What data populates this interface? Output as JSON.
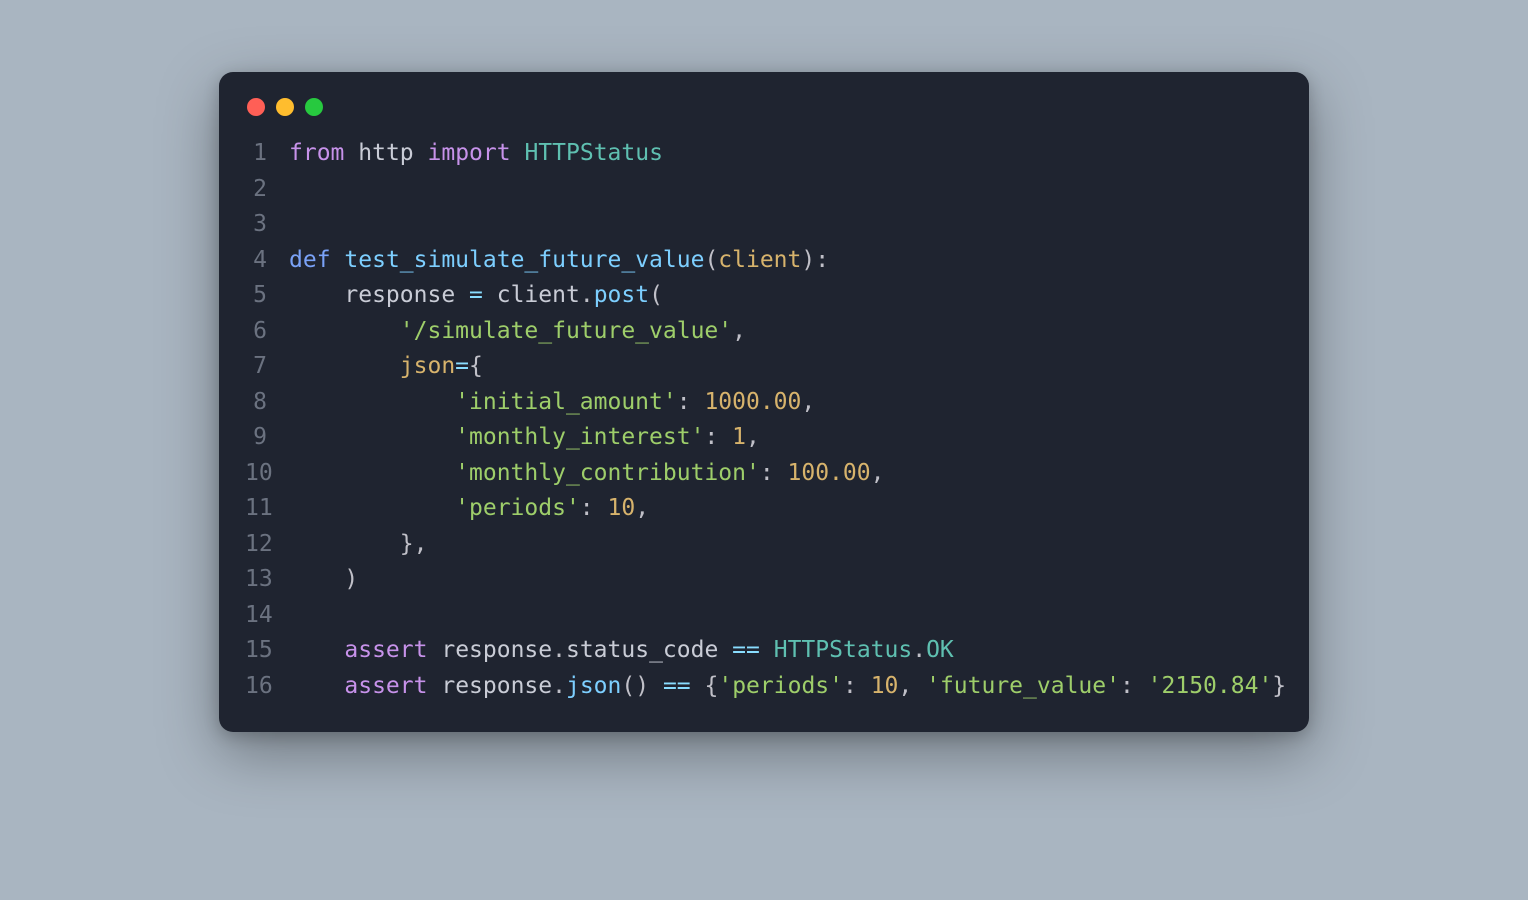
{
  "window": {
    "traffic_lights": {
      "red": "red",
      "yellow": "yellow",
      "green": "green"
    }
  },
  "gutter": [
    "1",
    "2",
    "3",
    "4",
    "5",
    "6",
    "7",
    "8",
    "9",
    "10",
    "11",
    "12",
    "13",
    "14",
    "15",
    "16"
  ],
  "code": {
    "l1": {
      "from": "from",
      "mod": "http",
      "import": "import",
      "cls": "HTTPStatus"
    },
    "l4": {
      "def": "def",
      "fn": "test_simulate_future_value",
      "lp": "(",
      "param": "client",
      "rp": "):"
    },
    "l5": {
      "lhs": "    response ",
      "eq": "=",
      "sp": " ",
      "obj": "client",
      "dot": ".",
      "meth": "post",
      "lp": "("
    },
    "l6": {
      "indent": "        ",
      "str": "'/simulate_future_value'",
      "comma": ","
    },
    "l7": {
      "indent": "        ",
      "kw": "json",
      "eq": "=",
      "brace": "{"
    },
    "l8": {
      "indent": "            ",
      "key": "'initial_amount'",
      "colon": ": ",
      "val": "1000.00",
      "comma": ","
    },
    "l9": {
      "indent": "            ",
      "key": "'monthly_interest'",
      "colon": ": ",
      "val": "1",
      "comma": ","
    },
    "l10": {
      "indent": "            ",
      "key": "'monthly_contribution'",
      "colon": ": ",
      "val": "100.00",
      "comma": ","
    },
    "l11": {
      "indent": "            ",
      "key": "'periods'",
      "colon": ": ",
      "val": "10",
      "comma": ","
    },
    "l12": {
      "indent": "        ",
      "brace": "},",
      "extra": ""
    },
    "l13": {
      "indent": "    ",
      "rp": ")"
    },
    "l15": {
      "indent": "    ",
      "assert": "assert",
      "sp": " ",
      "obj": "response",
      "dot1": ".",
      "attr": "status_code",
      "sp2": " ",
      "eq": "==",
      "sp3": " ",
      "cls": "HTTPStatus",
      "dot2": ".",
      "ok": "OK"
    },
    "l16": {
      "indent": "    ",
      "assert": "assert",
      "sp": " ",
      "obj": "response",
      "dot": ".",
      "meth": "json",
      "call": "()",
      "sp2": " ",
      "eq": "==",
      "sp3": " ",
      "lb": "{",
      "k1": "'periods'",
      "c1": ": ",
      "v1": "10",
      "comma": ", ",
      "k2": "'future_value'",
      "c2": ": ",
      "v2": "'2150.84'",
      "rb": "}"
    }
  }
}
